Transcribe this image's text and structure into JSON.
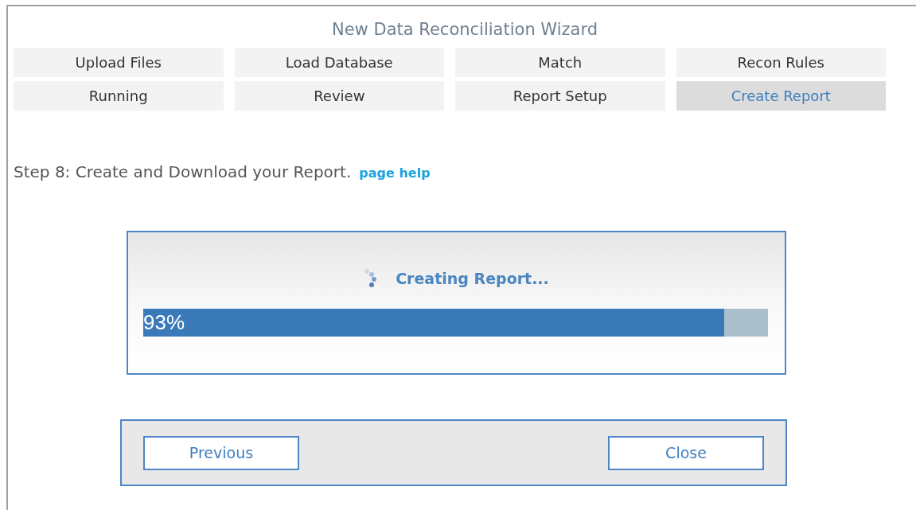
{
  "window": {
    "title": "New Data Reconciliation Wizard"
  },
  "tabs": [
    {
      "label": "Upload Files",
      "selected": false
    },
    {
      "label": "Load Database",
      "selected": false
    },
    {
      "label": "Match",
      "selected": false
    },
    {
      "label": "Recon Rules",
      "selected": false
    },
    {
      "label": "Running",
      "selected": false
    },
    {
      "label": "Review",
      "selected": false
    },
    {
      "label": "Report Setup",
      "selected": false
    },
    {
      "label": "Create Report",
      "selected": true
    }
  ],
  "step": {
    "text": "Step 8: Create and Download your Report.",
    "help_link": "page help"
  },
  "progress": {
    "message": "Creating Report...",
    "level": 0.93,
    "reading": "93%"
  },
  "buttons": [
    "Previous",
    "Close"
  ]
}
